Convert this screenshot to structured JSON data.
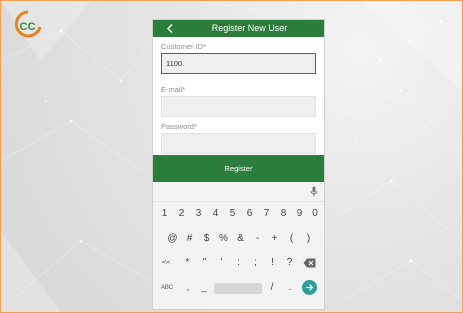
{
  "app": {
    "logo_icon": "cc-logo-icon"
  },
  "header": {
    "title": "Register New User",
    "back_icon": "chevron-left-icon"
  },
  "form": {
    "customer_id_label": "Customer ID*",
    "customer_id_value": "1100",
    "email_label": "E-mail*",
    "email_value": "",
    "password_label": "Password*",
    "password_value": ""
  },
  "register_button": "Register",
  "keyboard": {
    "mic_icon": "microphone-icon",
    "number_row": [
      "1",
      "2",
      "3",
      "4",
      "5",
      "6",
      "7",
      "8",
      "9",
      "0"
    ],
    "symbol_row": [
      "@",
      "#",
      "$",
      "%",
      "&",
      "-",
      "+",
      "(",
      ")"
    ],
    "third_row": [
      "=\\<",
      "*",
      "\"",
      "'",
      ":",
      ";",
      "!",
      "?"
    ],
    "backspace_icon": "backspace-icon",
    "bottom_row": {
      "abc": "ABC",
      "comma": ",",
      "underscore": "_",
      "slash": "/",
      "dot": "."
    },
    "enter_icon": "arrow-right-icon"
  },
  "colors": {
    "brand_green": "#2a7d3a",
    "enter_teal": "#2f9e9a",
    "logo_orange": "#e8821f",
    "logo_green": "#3a8a3a"
  }
}
